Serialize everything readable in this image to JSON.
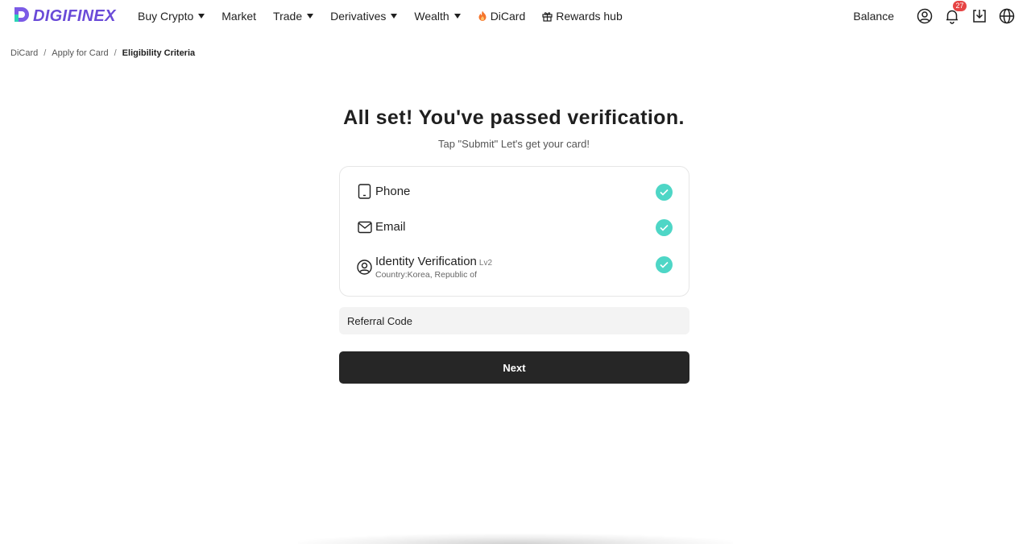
{
  "brand": {
    "name": "DIGIFINEX",
    "logo_icon": "digifinex-logo-icon",
    "color": "#6a4bd8"
  },
  "nav": {
    "items": [
      {
        "label": "Buy Crypto",
        "dropdown": true
      },
      {
        "label": "Market",
        "dropdown": false
      },
      {
        "label": "Trade",
        "dropdown": true
      },
      {
        "label": "Derivatives",
        "dropdown": true
      },
      {
        "label": "Wealth",
        "dropdown": true
      },
      {
        "label": "DiCard",
        "icon": "fire-icon"
      },
      {
        "label": "Rewards hub",
        "icon": "gift-icon"
      }
    ],
    "right": {
      "balance_label": "Balance",
      "icons": [
        "user-icon",
        "bell-icon",
        "download-icon",
        "globe-icon"
      ],
      "notification_count": "27"
    }
  },
  "breadcrumb": {
    "items": [
      "DiCard",
      "Apply for Card",
      "Eligibility Criteria"
    ],
    "separator": "/"
  },
  "main": {
    "title": "All set! You've passed verification.",
    "subtitle": "Tap \"Submit\" Let's get your card!",
    "checks": [
      {
        "label": "Phone",
        "icon": "phone-icon",
        "status": "verified"
      },
      {
        "label": "Email",
        "icon": "envelope-icon",
        "status": "verified"
      },
      {
        "label": "Identity Verification",
        "level": "Lv2",
        "detail": "Country:Korea, Republic of",
        "icon": "user-circle-icon",
        "status": "verified"
      }
    ],
    "referral_placeholder": "Referral Code",
    "next_label": "Next"
  },
  "colors": {
    "check": "#4ed6c6",
    "button": "#262626",
    "badge": "#e64545"
  }
}
